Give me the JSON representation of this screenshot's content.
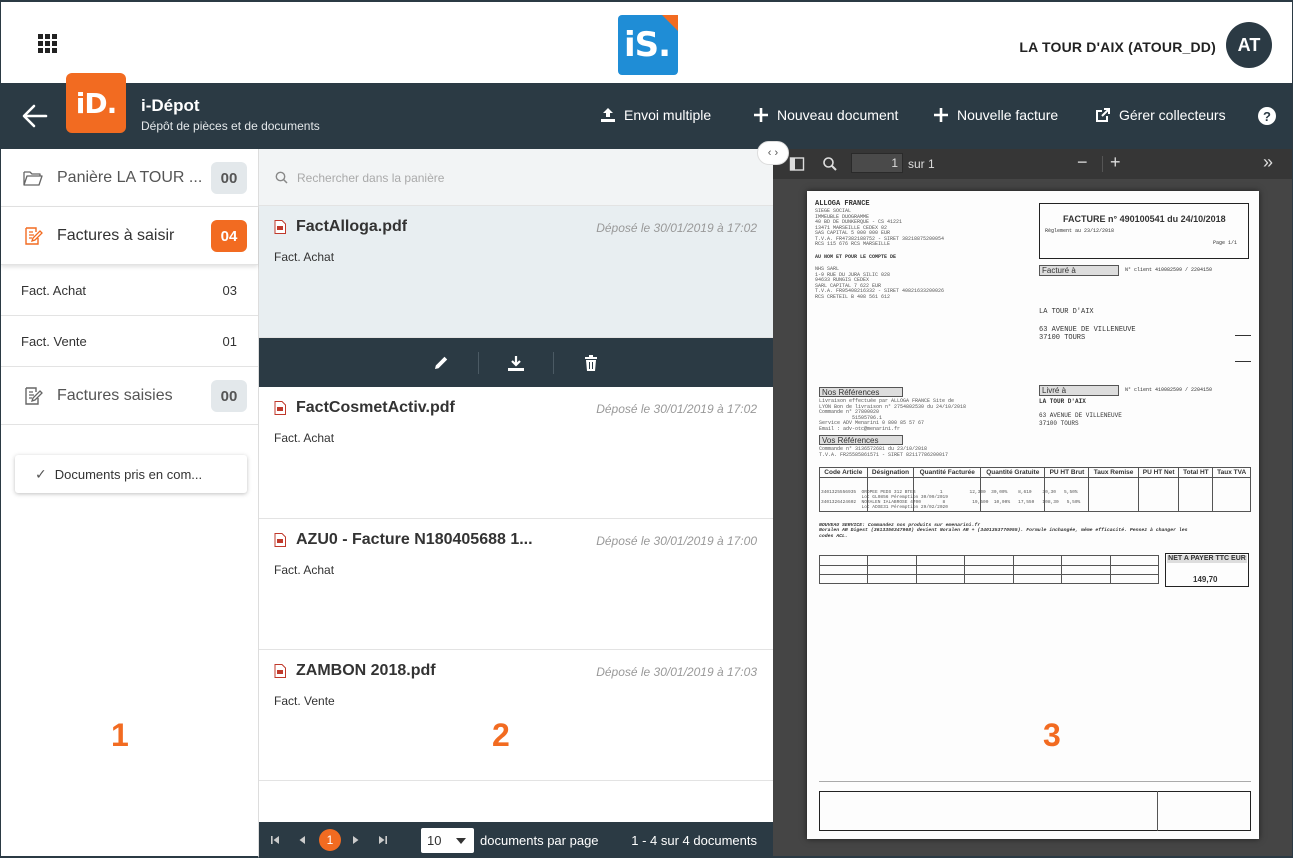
{
  "topbar": {
    "user_name": "LA TOUR D'AIX (ATOUR_DD)",
    "avatar_initials": "AT",
    "logo_text": "iS."
  },
  "header": {
    "logo_text": "iD.",
    "title": "i-Dépot",
    "subtitle": "Dépôt de pièces et de documents",
    "actions": {
      "envoi": "Envoi multiple",
      "nouveau_doc": "Nouveau document",
      "nouvelle_facture": "Nouvelle facture",
      "gerer": "Gérer collecteurs"
    },
    "help": "?"
  },
  "sidebar": {
    "categories": [
      {
        "label": "Panière LA TOUR ...",
        "count": "00"
      },
      {
        "label": "Factures à saisir",
        "count": "04"
      },
      {
        "label": "Factures saisies",
        "count": "00"
      }
    ],
    "subitems": [
      {
        "label": "Fact. Achat",
        "count": "03"
      },
      {
        "label": "Fact. Vente",
        "count": "01"
      }
    ],
    "docs_button": "Documents pris en com...",
    "annotation": "1"
  },
  "list": {
    "search_placeholder": "Rechercher dans la panière",
    "documents": [
      {
        "name": "FactAlloga.pdf",
        "date": "Déposé le 30/01/2019 à 17:02",
        "type": "Fact. Achat"
      },
      {
        "name": "FactCosmetActiv.pdf",
        "date": "Déposé le 30/01/2019 à 17:02",
        "type": "Fact. Achat"
      },
      {
        "name": "AZU0 - Facture N180405688 1...",
        "date": "Déposé le 30/01/2019 à 17:00",
        "type": "Fact. Achat"
      },
      {
        "name": "ZAMBON 2018.pdf",
        "date": "Déposé le 30/01/2019 à 17:03",
        "type": "Fact. Vente"
      }
    ],
    "pager": {
      "current_page": "1",
      "per_page": "10",
      "per_page_label": "documents par page",
      "range": "1 - 4 sur 4 documents"
    },
    "annotation": "2"
  },
  "viewer": {
    "page_input": "1",
    "page_total": "sur 1",
    "annotation": "3",
    "invoice": {
      "vendor": "ALLOGA FRANCE",
      "title": "FACTURE n° 490100541 du 24/10/2018",
      "reglement": "Règlement au 23/12/2018",
      "page": "Page 1/1",
      "facture_a": "Facturé à",
      "client_no": "N° client 410082599 / 2204150",
      "customer": "LA TOUR D'AIX",
      "address1": "63 AVENUE DE VILLENEUVE",
      "address2": "37100 TOURS",
      "livre_a": "Livré à",
      "client_no2": "N° client 410082599 / 2204150",
      "customer2": "LA TOUR D'AIX",
      "address3": "63 AVENUE DE VILLENEUVE",
      "address4": "37100 TOURS",
      "nos_refs": "Nos Références",
      "vos_refs": "Vos Références",
      "net_label": "NET A PAYER TTC EUR",
      "net_value": "149,70",
      "table_headers": [
        "Code Article",
        "Désignation",
        "Quantité Facturée",
        "Quantité Gratuite",
        "PU HT Brut",
        "Taux Remise",
        "PU HT Net",
        "Total HT",
        "Taux TVA"
      ]
    }
  }
}
